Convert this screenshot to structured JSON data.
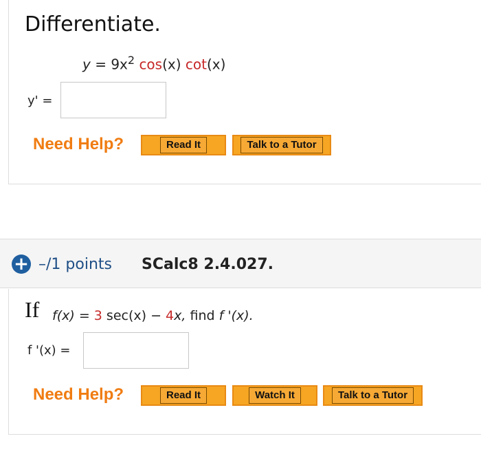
{
  "problem1": {
    "title": "Differentiate.",
    "equation": {
      "lhs": "y",
      "eq": "=",
      "coeff": "9x",
      "exp": "2",
      "cos": "cos",
      "cos_arg": "(x)",
      "cot": "cot",
      "cot_arg": "(x)"
    },
    "answer_label": "y' =",
    "answer_value": "",
    "need_help": "Need Help?",
    "buttons": {
      "read": "Read It",
      "tutor": "Talk to a Tutor"
    }
  },
  "problem2": {
    "header": {
      "expand_icon": "plus-circle-icon",
      "points": "–/1 points",
      "code": "SCalc8 2.4.027."
    },
    "question": {
      "if_word": "If",
      "fx": "f(x)",
      "eq": "=",
      "coef1": "3",
      "sec": "sec(x)",
      "minus": "−",
      "coef2": "4",
      "x_term": "x,",
      "find": "find",
      "fpx": "f '(x)."
    },
    "answer_label": "f '(x) =",
    "answer_value": "",
    "need_help": "Need Help?",
    "buttons": {
      "read": "Read It",
      "watch": "Watch It",
      "tutor": "Talk to a Tutor"
    }
  },
  "colors": {
    "accent_orange": "#f07c12",
    "button_orange": "#f6a623",
    "math_red": "#c62828",
    "points_blue": "#1f4f86"
  }
}
